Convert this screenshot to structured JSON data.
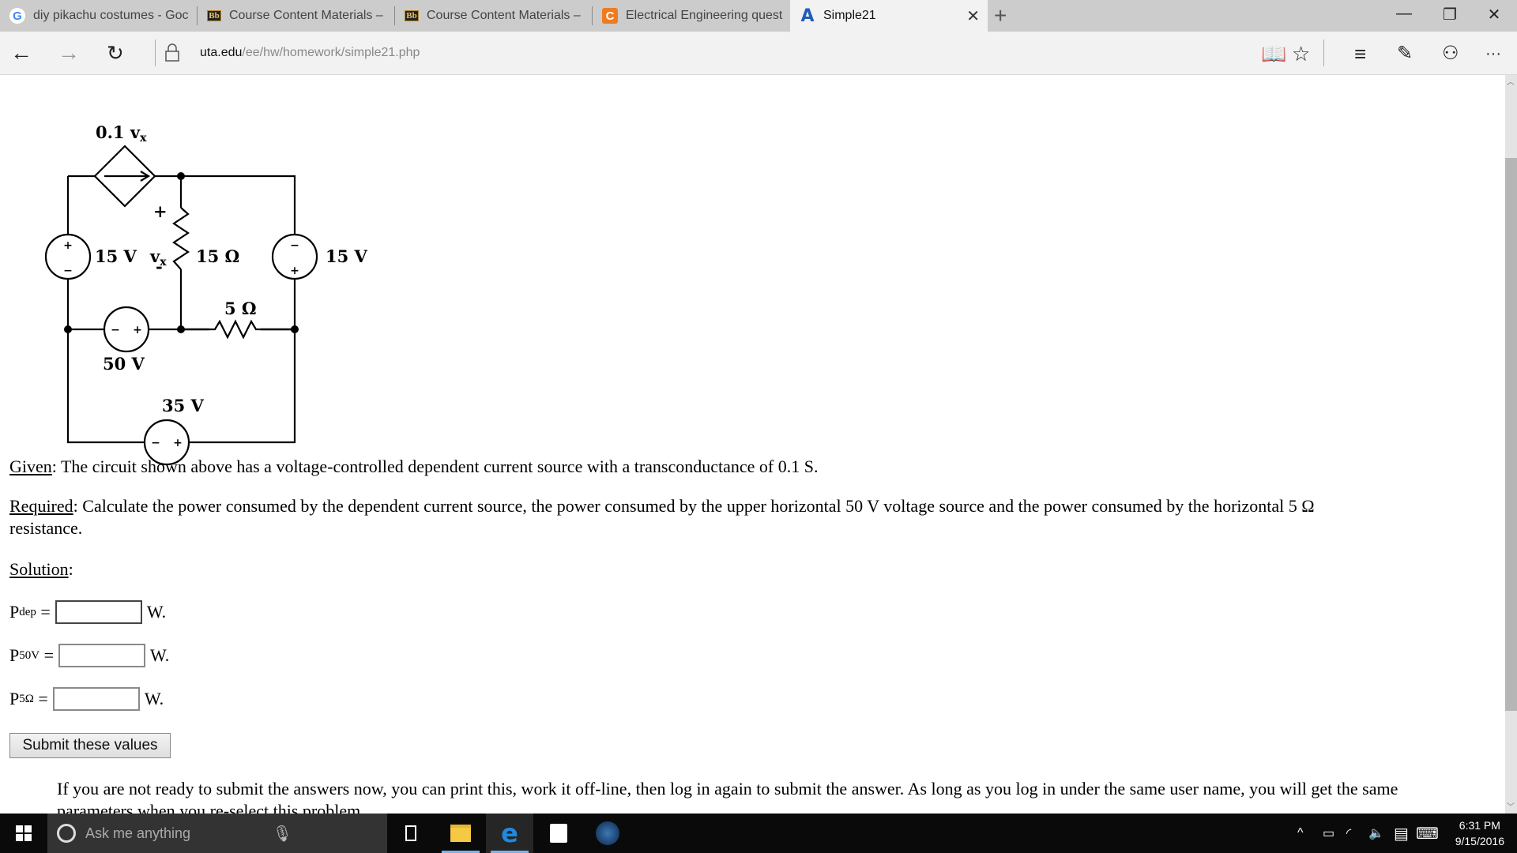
{
  "browser": {
    "tabs": [
      {
        "label": "diy pikachu costumes - Goc",
        "icon": "google-icon"
      },
      {
        "label": "Course Content Materials –",
        "icon": "blackboard-icon"
      },
      {
        "label": "Course Content Materials –",
        "icon": "blackboard-icon"
      },
      {
        "label": "Electrical Engineering quest",
        "icon": "chegg-icon"
      },
      {
        "label": "Simple21",
        "icon": "uta-icon",
        "active": true
      }
    ],
    "url_domain": "uta.edu",
    "url_path": "/ee/hw/homework/simple21.php"
  },
  "circuit": {
    "dep_source_label": "0.1 v",
    "dep_source_sub": "x",
    "left_source": "15 V",
    "vx_label": "v",
    "vx_sub": "x",
    "vx_plus": "+",
    "vx_minus": "-",
    "r15": "15 Ω",
    "right_source": "15 V",
    "r5": "5 Ω",
    "mid_source": "50 V",
    "bottom_source": "35 V"
  },
  "problem": {
    "given_label": "Given",
    "given_text": ": The circuit shown above has a voltage-controlled dependent current source with a transconductance of 0.1 S.",
    "required_label": "Required",
    "required_text": ": Calculate the power consumed by the dependent current source, the power consumed by the upper horizontal 50 V voltage source and the power consumed by the horizontal 5 Ω",
    "required_text2": "resistance.",
    "solution_label": "Solution",
    "answers": [
      {
        "symbol": "P",
        "sub": "dep",
        "value": "",
        "unit": "W."
      },
      {
        "symbol": "P",
        "sub": "50V",
        "value": "",
        "unit": "W."
      },
      {
        "symbol": "P",
        "sub": "5Ω",
        "value": "",
        "unit": "W."
      }
    ],
    "submit_label": "Submit these values",
    "note": "If you are not ready to submit the answers now, you can print this, work it off-line, then log in again to submit the answer. As long as you log in under the same user name, you will get the same parameters when you re-select this problem."
  },
  "taskbar": {
    "search_placeholder": "Ask me anything",
    "time": "6:31 PM",
    "date": "9/15/2016"
  }
}
